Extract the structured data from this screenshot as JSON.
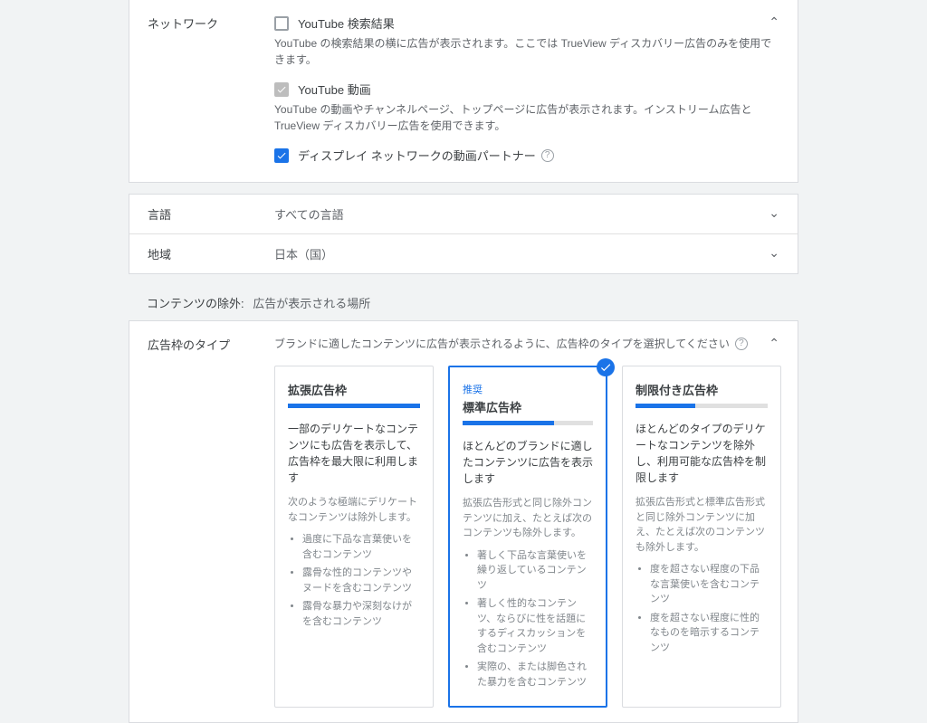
{
  "network": {
    "label": "ネットワーク",
    "items": [
      {
        "label": "YouTube 検索結果",
        "desc": "YouTube の検索結果の横に広告が表示されます。ここでは TrueView ディスカバリー広告のみを使用できます。",
        "state": "unchecked"
      },
      {
        "label": "YouTube 動画",
        "desc": "YouTube の動画やチャンネルページ、トップページに広告が表示されます。インストリーム広告と TrueView ディスカバリー広告を使用できます。",
        "state": "disabled-checked"
      },
      {
        "label": "ディスプレイ ネットワークの動画パートナー",
        "desc": "",
        "state": "checked",
        "help": true
      }
    ]
  },
  "language": {
    "label": "言語",
    "value": "すべての言語"
  },
  "region": {
    "label": "地域",
    "value": "日本（国）"
  },
  "exclusion": {
    "title": "コンテンツの除外:",
    "subtitle": "広告が表示される場所"
  },
  "inventory": {
    "label": "広告枠のタイプ",
    "instruction": "ブランドに適したコンテンツに広告が表示されるように、広告枠のタイプを選択してください",
    "cards": [
      {
        "title": "拡張広告枠",
        "fill": 100,
        "sub": "一部のデリケートなコンテンツにも広告を表示して、広告枠を最大限に利用します",
        "note": "次のような極端にデリケートなコンテンツは除外します。",
        "bullets": [
          "過度に下品な言葉使いを含むコンテンツ",
          "露骨な性的コンテンツやヌードを含むコンテンツ",
          "露骨な暴力や深刻なけがを含むコンテンツ"
        ]
      },
      {
        "title": "標準広告枠",
        "rec": "推奨",
        "fill": 70,
        "selected": true,
        "sub": "ほとんどのブランドに適したコンテンツに広告を表示します",
        "note": "拡張広告形式と同じ除外コンテンツに加え、たとえば次のコンテンツも除外します。",
        "bullets": [
          "著しく下品な言葉使いを繰り返しているコンテンツ",
          "著しく性的なコンテンツ、ならびに性を話題にするディスカッションを含むコンテンツ",
          "実際の、または脚色された暴力を含むコンテンツ"
        ]
      },
      {
        "title": "制限付き広告枠",
        "fill": 45,
        "sub": "ほとんどのタイプのデリケートなコンテンツを除外し、利用可能な広告枠を制限します",
        "note": "拡張広告形式と標準広告形式と同じ除外コンテンツに加え、たとえば次のコンテンツも除外します。",
        "bullets": [
          "度を超さない程度の下品な言葉使いを含むコンテンツ",
          "度を超さない程度に性的なものを暗示するコンテンツ"
        ]
      }
    ]
  }
}
